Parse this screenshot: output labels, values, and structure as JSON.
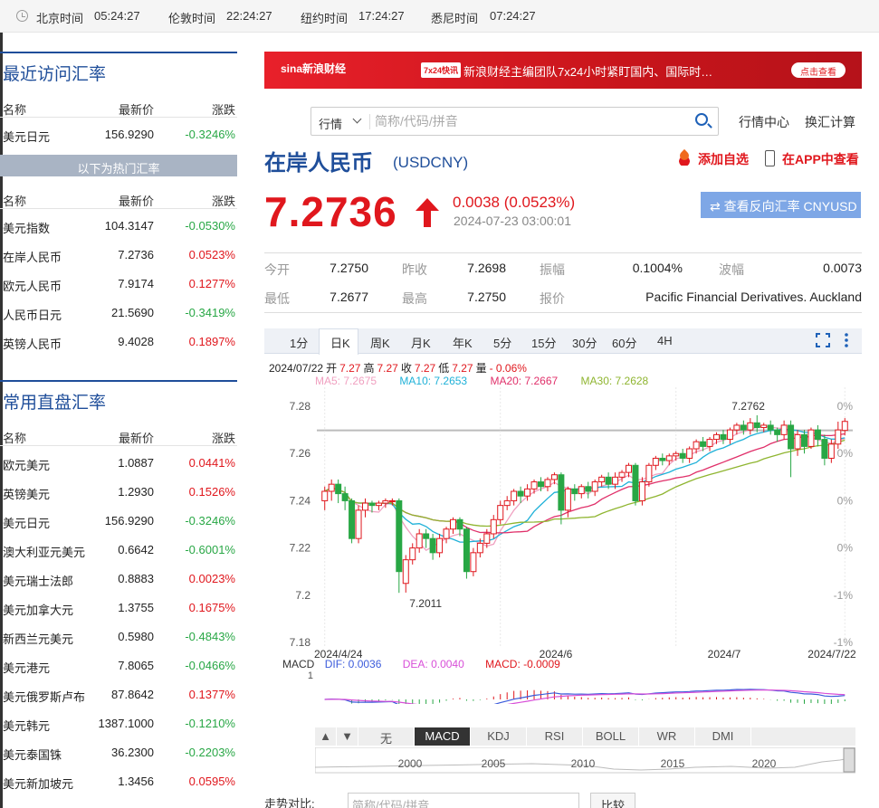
{
  "clocks": [
    {
      "city": "北京时间",
      "time": "05:24:27"
    },
    {
      "city": "伦敦时间",
      "time": "22:24:27"
    },
    {
      "city": "纽约时间",
      "time": "17:24:27"
    },
    {
      "city": "悉尼时间",
      "time": "07:24:27"
    }
  ],
  "recent": {
    "title": "最近访问汇率",
    "cols": {
      "name": "名称",
      "price": "最新价",
      "chg": "涨跌"
    },
    "rows": [
      {
        "name": "美元日元",
        "price": "156.9290",
        "chg": "-0.3246%",
        "dir": "dn"
      }
    ],
    "hot_label": "以下为热门汇率",
    "hot_cols": {
      "name": "名称",
      "price": "最新价",
      "chg": "涨跌"
    },
    "hot_rows": [
      {
        "name": "美元指数",
        "price": "104.3147",
        "chg": "-0.0530%",
        "dir": "dn"
      },
      {
        "name": "在岸人民币",
        "price": "7.2736",
        "chg": "0.0523%",
        "dir": "up"
      },
      {
        "name": "欧元人民币",
        "price": "7.9174",
        "chg": "0.1277%",
        "dir": "up"
      },
      {
        "name": "人民币日元",
        "price": "21.5690",
        "chg": "-0.3419%",
        "dir": "dn"
      },
      {
        "name": "英镑人民币",
        "price": "9.4028",
        "chg": "0.1897%",
        "dir": "up"
      }
    ]
  },
  "direct": {
    "title": "常用直盘汇率",
    "cols": {
      "name": "名称",
      "price": "最新价",
      "chg": "涨跌"
    },
    "rows": [
      {
        "name": "欧元美元",
        "price": "1.0887",
        "chg": "0.0441%",
        "dir": "up"
      },
      {
        "name": "英镑美元",
        "price": "1.2930",
        "chg": "0.1526%",
        "dir": "up"
      },
      {
        "name": "美元日元",
        "price": "156.9290",
        "chg": "-0.3246%",
        "dir": "dn"
      },
      {
        "name": "澳大利亚元美元",
        "price": "0.6642",
        "chg": "-0.6001%",
        "dir": "dn"
      },
      {
        "name": "美元瑞士法郎",
        "price": "0.8883",
        "chg": "0.0023%",
        "dir": "up"
      },
      {
        "name": "美元加拿大元",
        "price": "1.3755",
        "chg": "0.1675%",
        "dir": "up"
      },
      {
        "name": "新西兰元美元",
        "price": "0.5980",
        "chg": "-0.4843%",
        "dir": "dn"
      },
      {
        "name": "美元港元",
        "price": "7.8065",
        "chg": "-0.0466%",
        "dir": "dn"
      },
      {
        "name": "美元俄罗斯卢布",
        "price": "87.8642",
        "chg": "0.1377%",
        "dir": "up"
      },
      {
        "name": "美元韩元",
        "price": "1387.1000",
        "chg": "-0.1210%",
        "dir": "dn"
      },
      {
        "name": "美元泰国铢",
        "price": "36.2300",
        "chg": "-0.2203%",
        "dir": "dn"
      },
      {
        "name": "美元新加坡元",
        "price": "1.3456",
        "chg": "0.0595%",
        "dir": "up"
      }
    ]
  },
  "banner": {
    "logo": "sina新浪财经",
    "tag": "7x24快讯",
    "text": "新浪财经主编团队7x24小时紧盯国内、国际时…",
    "button": "点击查看"
  },
  "search": {
    "scope": "行情",
    "placeholder": "简称/代码/拼音"
  },
  "links": {
    "center": "行情中心",
    "calc": "换汇计算"
  },
  "quote": {
    "name": "在岸人民币",
    "symbol": "(USDCNY)",
    "add_fav": "添加自选",
    "app_view": "在APP中查看",
    "price": "7.2736",
    "change": "0.0038 (0.0523%)",
    "time": "2024-07-23 03:00:01",
    "reverse": "⇄ 查看反向汇率 CNYUSD",
    "colors": {
      "up": "#e0171d",
      "down": "#28a745",
      "brand": "#1f4e9a"
    }
  },
  "stats": [
    {
      "label": "今开",
      "value": "7.2750"
    },
    {
      "label": "昨收",
      "value": "7.2698"
    },
    {
      "label": "振幅",
      "value": "0.1004%"
    },
    {
      "label": "波幅",
      "value": "0.0073"
    },
    {
      "label": "最低",
      "value": "7.2677"
    },
    {
      "label": "最高",
      "value": "7.2750"
    },
    {
      "label": "报价",
      "value": "Pacific Financial Derivatives. Auckland"
    }
  ],
  "tabs": [
    "1分",
    "日K",
    "周K",
    "月K",
    "年K",
    "5分",
    "15分",
    "30分",
    "60分",
    "4H"
  ],
  "active_tab": "日K",
  "ohlc": {
    "date": "2024/07/22",
    "open_l": "开",
    "open": "7.27",
    "high_l": "高",
    "high": "7.27",
    "close_l": "收",
    "close": "7.27",
    "low_l": "低",
    "low": "7.27",
    "vol_l": "量",
    "chg": "- 0.06%"
  },
  "ma": [
    {
      "label": "MA5: 7.2675",
      "color": "#f0a0c0"
    },
    {
      "label": "MA10: 7.2653",
      "color": "#1fb1d8"
    },
    {
      "label": "MA20: 7.2667",
      "color": "#e0306a"
    },
    {
      "label": "MA30: 7.2628",
      "color": "#8fb530"
    }
  ],
  "macd_legend": [
    {
      "label": "MACD",
      "color": "#333"
    },
    {
      "label": "DIF: 0.0036",
      "color": "#3b5bdb"
    },
    {
      "label": "DEA: 0.0040",
      "color": "#d84fd8"
    },
    {
      "label": "MACD: -0.0009",
      "color": "#e0171d"
    }
  ],
  "indicators": [
    "▲",
    "▼",
    "无",
    "MACD",
    "KDJ",
    "RSI",
    "BOLL",
    "WR",
    "DMI"
  ],
  "active_indicator": "MACD",
  "overview_years": [
    "2000",
    "2005",
    "2010",
    "2015",
    "2020"
  ],
  "compare": {
    "label": "走势对比:",
    "placeholder": "简称/代码/拼音",
    "button": "比较"
  },
  "chart_data": {
    "type": "candlestick",
    "y_ticks": [
      "7.28",
      "7.26",
      "7.24",
      "7.22",
      "7.2",
      "7.18"
    ],
    "pct_ticks": [
      "0%",
      "0%",
      "0%",
      "0%",
      "-1%",
      "-1%"
    ],
    "x_ticks": [
      "2024/4/24",
      "2024/6",
      "2024/7",
      "2024/7/22"
    ],
    "ylim": [
      7.18,
      7.285
    ],
    "annotations": [
      {
        "label": "7.2762",
        "value": 7.2762
      },
      {
        "label": "7.2011",
        "value": 7.2011
      }
    ],
    "macd_ticks": [
      "1",
      "-1"
    ],
    "candles": [
      [
        7.24,
        7.244,
        7.236,
        7.246
      ],
      [
        7.244,
        7.247,
        7.24,
        7.249
      ],
      [
        7.247,
        7.243,
        7.239,
        7.249
      ],
      [
        7.243,
        7.24,
        7.236,
        7.246
      ],
      [
        7.24,
        7.224,
        7.222,
        7.241
      ],
      [
        7.224,
        7.236,
        7.222,
        7.238
      ],
      [
        7.236,
        7.239,
        7.233,
        7.241
      ],
      [
        7.239,
        7.238,
        7.235,
        7.24
      ],
      [
        7.238,
        7.239,
        7.236,
        7.24
      ],
      [
        7.239,
        7.24,
        7.237,
        7.241
      ],
      [
        7.24,
        7.24,
        7.238,
        7.241
      ],
      [
        7.24,
        7.21,
        7.201,
        7.241
      ],
      [
        7.205,
        7.215,
        7.2011,
        7.217
      ],
      [
        7.215,
        7.22,
        7.213,
        7.222
      ],
      [
        7.22,
        7.226,
        7.218,
        7.228
      ],
      [
        7.226,
        7.224,
        7.22,
        7.228
      ],
      [
        7.224,
        7.218,
        7.215,
        7.226
      ],
      [
        7.218,
        7.224,
        7.216,
        7.226
      ],
      [
        7.224,
        7.228,
        7.222,
        7.229
      ],
      [
        7.228,
        7.232,
        7.226,
        7.233
      ],
      [
        7.232,
        7.228,
        7.225,
        7.233
      ],
      [
        7.228,
        7.21,
        7.207,
        7.229
      ],
      [
        7.21,
        7.218,
        7.208,
        7.22
      ],
      [
        7.218,
        7.222,
        7.216,
        7.224
      ],
      [
        7.222,
        7.226,
        7.22,
        7.228
      ],
      [
        7.226,
        7.232,
        7.224,
        7.234
      ],
      [
        7.232,
        7.238,
        7.23,
        7.24
      ],
      [
        7.238,
        7.24,
        7.236,
        7.242
      ],
      [
        7.24,
        7.244,
        7.238,
        7.245
      ],
      [
        7.244,
        7.242,
        7.239,
        7.246
      ],
      [
        7.242,
        7.245,
        7.24,
        7.247
      ],
      [
        7.245,
        7.248,
        7.243,
        7.249
      ],
      [
        7.248,
        7.246,
        7.244,
        7.25
      ],
      [
        7.246,
        7.249,
        7.244,
        7.25
      ],
      [
        7.249,
        7.251,
        7.247,
        7.252
      ],
      [
        7.251,
        7.236,
        7.23,
        7.252
      ],
      [
        7.236,
        7.245,
        7.233,
        7.246
      ],
      [
        7.245,
        7.243,
        7.24,
        7.247
      ],
      [
        7.243,
        7.246,
        7.241,
        7.247
      ],
      [
        7.246,
        7.244,
        7.241,
        7.248
      ],
      [
        7.244,
        7.248,
        7.242,
        7.249
      ],
      [
        7.248,
        7.25,
        7.246,
        7.251
      ],
      [
        7.25,
        7.247,
        7.245,
        7.252
      ],
      [
        7.247,
        7.25,
        7.245,
        7.252
      ],
      [
        7.25,
        7.252,
        7.248,
        7.253
      ],
      [
        7.252,
        7.255,
        7.25,
        7.256
      ],
      [
        7.255,
        7.24,
        7.238,
        7.256
      ],
      [
        7.24,
        7.248,
        7.238,
        7.25
      ],
      [
        7.248,
        7.255,
        7.246,
        7.256
      ],
      [
        7.255,
        7.258,
        7.253,
        7.259
      ],
      [
        7.258,
        7.257,
        7.255,
        7.26
      ],
      [
        7.257,
        7.259,
        7.255,
        7.26
      ],
      [
        7.259,
        7.26,
        7.257,
        7.261
      ],
      [
        7.26,
        7.258,
        7.256,
        7.262
      ],
      [
        7.258,
        7.262,
        7.256,
        7.263
      ],
      [
        7.262,
        7.265,
        7.26,
        7.266
      ],
      [
        7.265,
        7.263,
        7.261,
        7.267
      ],
      [
        7.263,
        7.266,
        7.261,
        7.267
      ],
      [
        7.266,
        7.268,
        7.264,
        7.269
      ],
      [
        7.268,
        7.266,
        7.264,
        7.27
      ],
      [
        7.266,
        7.27,
        7.264,
        7.271
      ],
      [
        7.27,
        7.272,
        7.268,
        7.273
      ],
      [
        7.272,
        7.27,
        7.268,
        7.274
      ],
      [
        7.27,
        7.273,
        7.268,
        7.275
      ],
      [
        7.273,
        7.271,
        7.269,
        7.2762
      ],
      [
        7.271,
        7.272,
        7.269,
        7.273
      ],
      [
        7.272,
        7.27,
        7.268,
        7.274
      ],
      [
        7.27,
        7.268,
        7.265,
        7.271
      ],
      [
        7.268,
        7.272,
        7.266,
        7.274
      ],
      [
        7.272,
        7.262,
        7.25,
        7.274
      ],
      [
        7.262,
        7.268,
        7.259,
        7.27
      ],
      [
        7.268,
        7.263,
        7.26,
        7.27
      ],
      [
        7.263,
        7.27,
        7.262,
        7.271
      ],
      [
        7.27,
        7.266,
        7.263,
        7.272
      ],
      [
        7.266,
        7.258,
        7.255,
        7.268
      ],
      [
        7.258,
        7.264,
        7.256,
        7.266
      ],
      [
        7.264,
        7.27,
        7.262,
        7.2735
      ],
      [
        7.2698,
        7.2736,
        7.2677,
        7.275
      ]
    ]
  }
}
